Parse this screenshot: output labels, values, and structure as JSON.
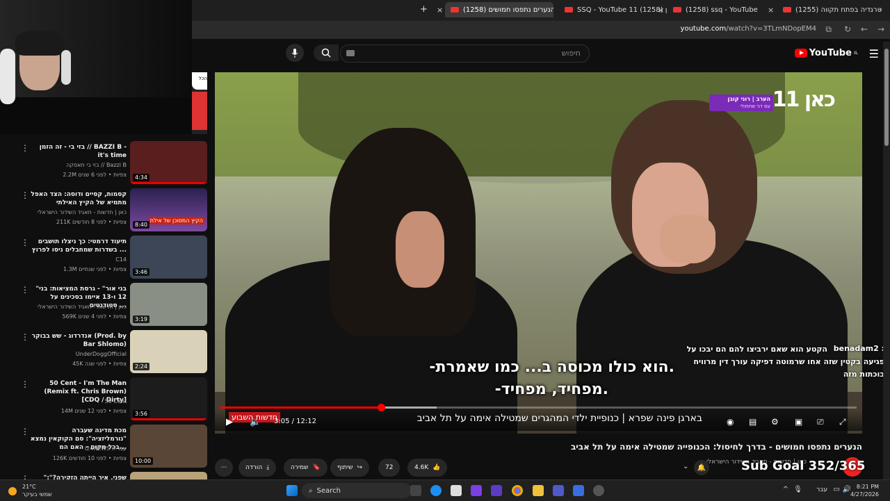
{
  "browser": {
    "tabs": [
      {
        "label": "(1255) הטרגדיה בפתח תקווה:",
        "active": false
      },
      {
        "label": "(1258) ssq - YouTube",
        "active": false
      },
      {
        "label": "SSQ - YouTube 11 (1258) כאן",
        "active": false
      },
      {
        "label": "(1258) הנערים נתפסו חמושים",
        "active": true
      }
    ],
    "new_tab": "+",
    "url_host": "youtube.com",
    "url_path": "/watch?v=3TLmNDopEM4"
  },
  "header": {
    "search_placeholder": "חיפוש",
    "logo_text": "YouTube",
    "logo_sup": "IL"
  },
  "sidebar_partial_button": "הכל",
  "sidebar": [
    {
      "title": "בזי בי - זה הזמן // BAZZI B - it's time",
      "channel": "בזי בי תאסקה // Bazzi B",
      "meta": "2.2M צפיות • לפני 6 שנים",
      "duration": "4:34",
      "thumb": "#5a1e1e",
      "progress": 1.0
    },
    {
      "title": "קסמות, קסיים ודוסה: הצד האפל מתמיא של הקיץ האילתי",
      "channel": "כאן | חדשות - תאגיד השידור הישראלי",
      "meta": "211K צפיות • לפני 8 חודשים",
      "duration": "8:40",
      "thumb": "#4b3a7a",
      "thumb_label": "הקיץ המסוכן של אילת",
      "progress": 0.0
    },
    {
      "title": "תיעוד דרמטי: כך ניצלו תושבים בשדרות שמחבלים ניסו לפרוץ ...",
      "channel": "C14",
      "meta": "1.3M צפיות • לפני שנתיים",
      "duration": "3:46",
      "thumb": "#3c4656",
      "progress": 0.0
    },
    {
      "title": "\"בני אור\" - גרסת המציאות: בני 12 ו-13 איימו בסכינים על סטודנטים ...",
      "channel": "כאן | חדשות - תאגיד השידור הישראלי",
      "meta": "569K צפיות • לפני 4 שנים",
      "duration": "3:19",
      "thumb": "#8a8f86",
      "progress": 0.0
    },
    {
      "title": "אנדרדוג - שש בבוקר (Prod. by Bar Shlomo)",
      "channel": "UnderDoggOfficial",
      "meta": "45K צפיות • לפני שנה",
      "duration": "2:24",
      "thumb": "#d9d1b8",
      "progress": 0.0
    },
    {
      "title": "50 Cent - I'm The Man (Remix ft. Chris Brown) [CDQ / Dirty]",
      "channel": "50 Cent",
      "meta": "14M צפיות • לפני 12 שנים",
      "duration": "3:56",
      "thumb": "#1c1c1c",
      "progress": 1.0
    },
    {
      "title": "מכת מדינה שעברה \"נורמליזציה\": סם הקוקאין נמצא בכל מקום - האם המ...",
      "channel": "i24NEWS עברית",
      "meta": "126K צפיות • לפני 10 חודשים",
      "duration": "10:00",
      "thumb": "#5a4636",
      "progress": 0.0
    },
    {
      "title": "\"שפני, איך הייתה הזקירה?\": משפחות",
      "channel": "",
      "meta": "",
      "duration": "",
      "thumb": "#b8a27a",
      "progress": 0.0
    }
  ],
  "player": {
    "channel_logo": "כאן 11",
    "lower_third_line1": "הערב | רוני קובן",
    "lower_third_line2": "עם דני שתחולי",
    "subtitle_1": "-הוא כולו מכוסה ב... כמו שאמרת.",
    "subtitle_2": "-מפחיד, מפחיד.",
    "ticker_brand": "חדשות השבוע",
    "ticker_text": "כנופיית ילדי המהגרים שמטילה אימה על תל אביב",
    "ticker_name": "בארגן פינה שפרא",
    "time": "3:05 / 12:12",
    "progress_fraction": 0.253,
    "buffer_fraction": 0.34
  },
  "chat": {
    "user": "benadam2 :",
    "line1": "הקטע הוא שאם ירביצו להם הם יבכו על",
    "line2": "פגיעה בקטין שזה אחו שרמוטה דפיקה עורך דין מרוויח",
    "line3": "בוכתות מזה"
  },
  "video": {
    "title": "הנערים נתפסו חמושים - בדרך לחיסול: הכנופייה שמטילה אימה על תל אביב",
    "channel": "כאן | חדשות - תאגיד השידור הישראלי",
    "likes": "4.6K",
    "comments": "72",
    "share": "שיתוף",
    "save": "שמירה",
    "download": "הורדה",
    "more": "⋯"
  },
  "overlay": {
    "sub_goal": "Sub Goal 352/365"
  },
  "taskbar": {
    "temp": "21°C",
    "weather": "שמשי בעיקר",
    "search": "Search",
    "lang": "עבר",
    "time": "8:21 PM",
    "date": "4/27/2026"
  }
}
